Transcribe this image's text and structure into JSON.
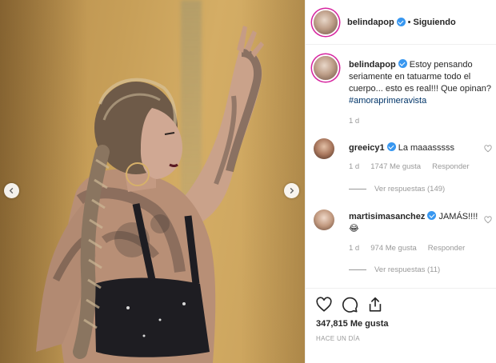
{
  "post": {
    "author": "belindapop",
    "follow_separator": "•",
    "follow_label": "Siguiendo",
    "caption_author": "belindapop",
    "caption_text": "Estoy pensando seriamente en tatuarme todo el cuerpo... esto es real!!! Que opinan?",
    "caption_hashtag": "#amoraprimeravista",
    "caption_age": "1 d",
    "likes": "347,815 Me gusta",
    "time_ago": "HACE UN DÍA",
    "accent_color": "#3897f0",
    "ring_color": "#d6249f"
  },
  "comments": [
    {
      "user": "greeicy1",
      "text": "La maaasssss",
      "age": "1 d",
      "likes": "1747 Me gusta",
      "reply_label": "Responder",
      "view_replies": "Ver respuestas (149)"
    },
    {
      "user": "martisimasanchez",
      "text": "JAMÁS!!!!",
      "emoji": "😂",
      "age": "1 d",
      "likes": "974 Me gusta",
      "reply_label": "Responder",
      "view_replies": "Ver respuestas (11)"
    }
  ],
  "icons": {
    "like": "heart-icon",
    "comment": "comment-icon",
    "share": "share-icon",
    "prev": "chevron-left-icon",
    "next": "chevron-right-icon",
    "verified": "verified-badge-icon"
  }
}
